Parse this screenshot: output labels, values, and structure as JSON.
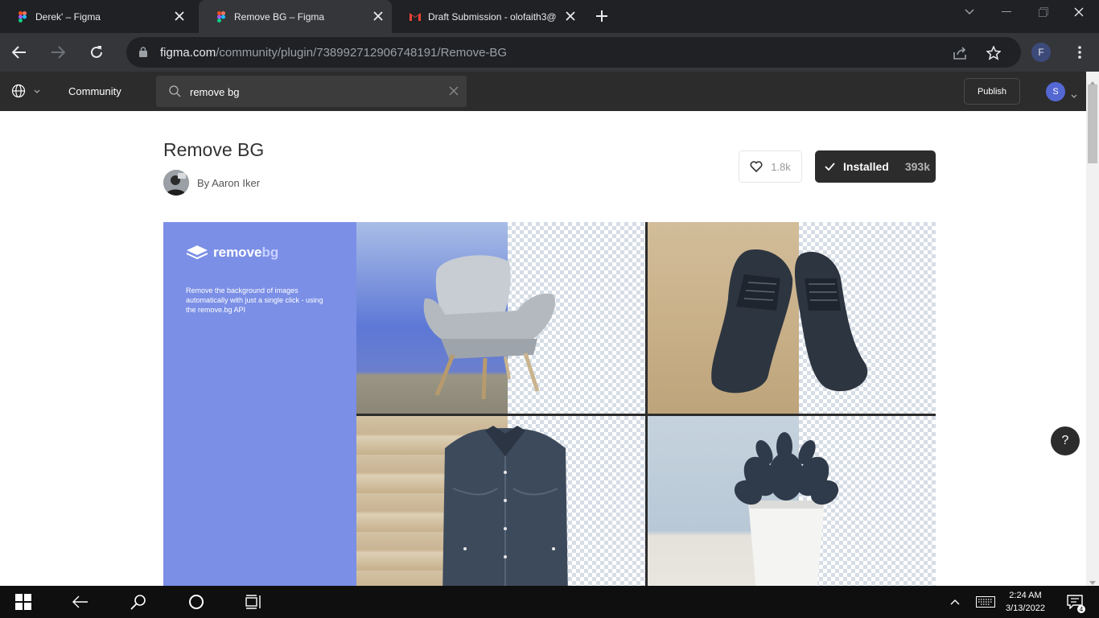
{
  "browser": {
    "tabs": [
      {
        "title": "Derek' – Figma",
        "icon": "figma-icon",
        "active": false
      },
      {
        "title": "Remove BG – Figma",
        "icon": "figma-icon",
        "active": true
      },
      {
        "title": "Draft Submission - olofaith3@",
        "icon": "gmail-icon",
        "active": false
      }
    ],
    "url_host": "figma.com",
    "url_path": "/community/plugin/738992712906748191/Remove-BG",
    "profile_initial": "F"
  },
  "figma_header": {
    "community_label": "Community",
    "search_value": "remove bg",
    "publish_label": "Publish",
    "user_initial": "S"
  },
  "plugin": {
    "title": "Remove BG",
    "author": "By Aaron Iker",
    "likes": "1.8k",
    "installed_label": "Installed",
    "installs": "393k"
  },
  "hero": {
    "logo_text_a": "remove",
    "logo_text_b": "bg",
    "description": "Remove the background of images automatically with just a single click - using the remove.bg API"
  },
  "help": {
    "label": "?"
  },
  "taskbar": {
    "time": "2:24 AM",
    "date": "3/13/2022",
    "notification_count": "4"
  },
  "colors": {
    "hero_blue": "#7b8fe6",
    "figma_dark": "#2c2c2c",
    "chrome_dark": "#202124"
  }
}
